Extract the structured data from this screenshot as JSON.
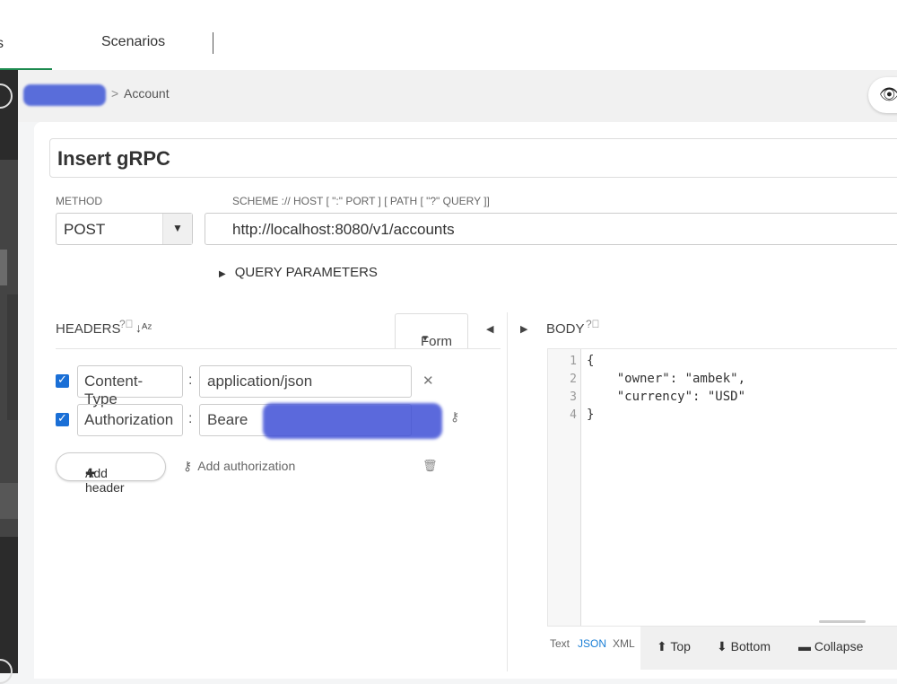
{
  "tabs": {
    "left_partial": "s",
    "scenarios": "Scenarios"
  },
  "breadcrumb": {
    "separator": ">",
    "current": "Account"
  },
  "request": {
    "name": "Insert gRPC",
    "method_label": "METHOD",
    "method": "POST",
    "url_label": "SCHEME :// HOST [ \":\" PORT ] [ PATH [ \"?\" QUERY ]]",
    "url": "http://localhost:8080/v1/accounts",
    "query_params_label": "QUERY PARAMETERS"
  },
  "headers": {
    "title": "HEADERS",
    "mode": "Form",
    "rows": [
      {
        "key": "Content-Type",
        "value": "application/json",
        "checked": true
      },
      {
        "key": "Authorization",
        "value": "Beare",
        "checked": true
      }
    ],
    "add_header": "Add header",
    "add_authorization": "Add authorization"
  },
  "body": {
    "title": "BODY",
    "line_numbers": [
      "1",
      "2",
      "3",
      "4"
    ],
    "lines": [
      "{",
      "    \"owner\": \"ambek\",",
      "    \"currency\": \"USD\"",
      "}"
    ],
    "formats": [
      "Text",
      "JSON",
      "XML"
    ],
    "active_format": "JSON",
    "tools": {
      "top": "Top",
      "bottom": "Bottom",
      "collapse": "Collapse"
    }
  },
  "colors": {
    "accent_green": "#1c8a4f",
    "checkbox_blue": "#1a6fd6",
    "json_key": "#a11"
  },
  "icons": [
    "eye-icon",
    "help-icon",
    "sort-icon",
    "close-icon",
    "key-icon",
    "trash-icon",
    "plus-icon",
    "caret-down-icon",
    "arrow-up-icon",
    "arrow-down-icon",
    "collapse-icon"
  ]
}
